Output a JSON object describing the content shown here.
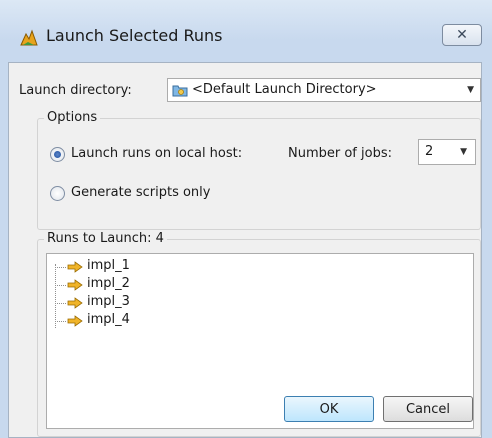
{
  "window": {
    "title": "Launch Selected Runs",
    "close_glyph": "✕",
    "icon": "launch-runs-icon"
  },
  "launch_directory": {
    "label": "Launch directory:",
    "value": "<Default Launch Directory>",
    "icon": "folder-icon"
  },
  "options": {
    "title": "Options",
    "local_host_label": "Launch runs on local host:",
    "local_host_checked": true,
    "scripts_only_label": "Generate scripts only",
    "scripts_only_checked": false,
    "jobs_label": "Number of jobs:",
    "jobs_value": "2"
  },
  "runs": {
    "title": "Runs to Launch: 4",
    "items": [
      {
        "label": "impl_1"
      },
      {
        "label": "impl_2"
      },
      {
        "label": "impl_3"
      },
      {
        "label": "impl_4"
      }
    ]
  },
  "buttons": {
    "ok": "OK",
    "cancel": "Cancel"
  },
  "colors": {
    "title_bar": "#c8d9ee",
    "client_bg": "#f0f0f0",
    "run_arrow": "#e8a31c"
  }
}
